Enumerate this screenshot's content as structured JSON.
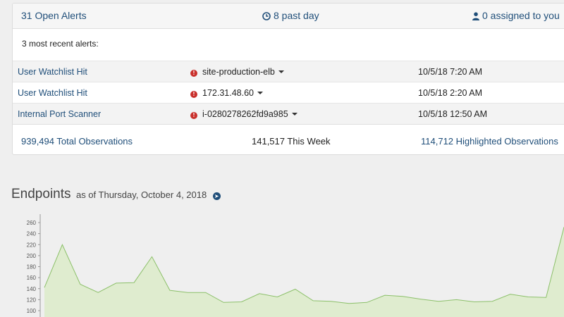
{
  "summary": {
    "open_alerts": "31 Open Alerts",
    "past_day": "8 past day",
    "assigned": "0 assigned to you"
  },
  "recent": {
    "label": "3 most recent alerts:",
    "alerts": [
      {
        "name": "User Watchlist Hit",
        "target": "site-production-elb",
        "time": "10/5/18 7:20 AM"
      },
      {
        "name": "User Watchlist Hit",
        "target": "172.31.48.60",
        "time": "10/5/18 2:20 AM"
      },
      {
        "name": "Internal Port Scanner",
        "target": "i-0280278262fd9a985",
        "time": "10/5/18 12:50 AM"
      }
    ]
  },
  "stats": {
    "total": "939,494 Total Observations",
    "week": "141,517 This Week",
    "highlighted": "114,712 Highlighted Observations"
  },
  "endpoints": {
    "title": "Endpoints",
    "as_of": "as of Thursday, October 4, 2018"
  },
  "colors": {
    "link": "#1f4e79",
    "alert_red": "#c9302c",
    "area_fill": "#dfeccf",
    "area_line": "#8cc06a"
  },
  "icons": {
    "clock": "clock-icon",
    "user": "user-icon",
    "warning": "exclamation-circle-icon",
    "go": "arrow-circle-right-icon"
  },
  "chart_data": {
    "type": "area",
    "title": "",
    "xlabel": "",
    "ylabel": "",
    "ylim": [
      100,
      270
    ],
    "yticks": [
      100,
      120,
      140,
      160,
      180,
      200,
      220,
      240,
      260
    ],
    "series": [
      {
        "values": [
          142,
          220,
          148,
          133,
          150,
          151,
          198,
          137,
          133,
          133,
          115,
          116,
          131,
          125,
          139,
          118,
          117,
          113,
          115,
          128,
          126,
          121,
          117,
          120,
          116,
          117,
          130,
          125,
          124,
          252
        ]
      }
    ]
  }
}
